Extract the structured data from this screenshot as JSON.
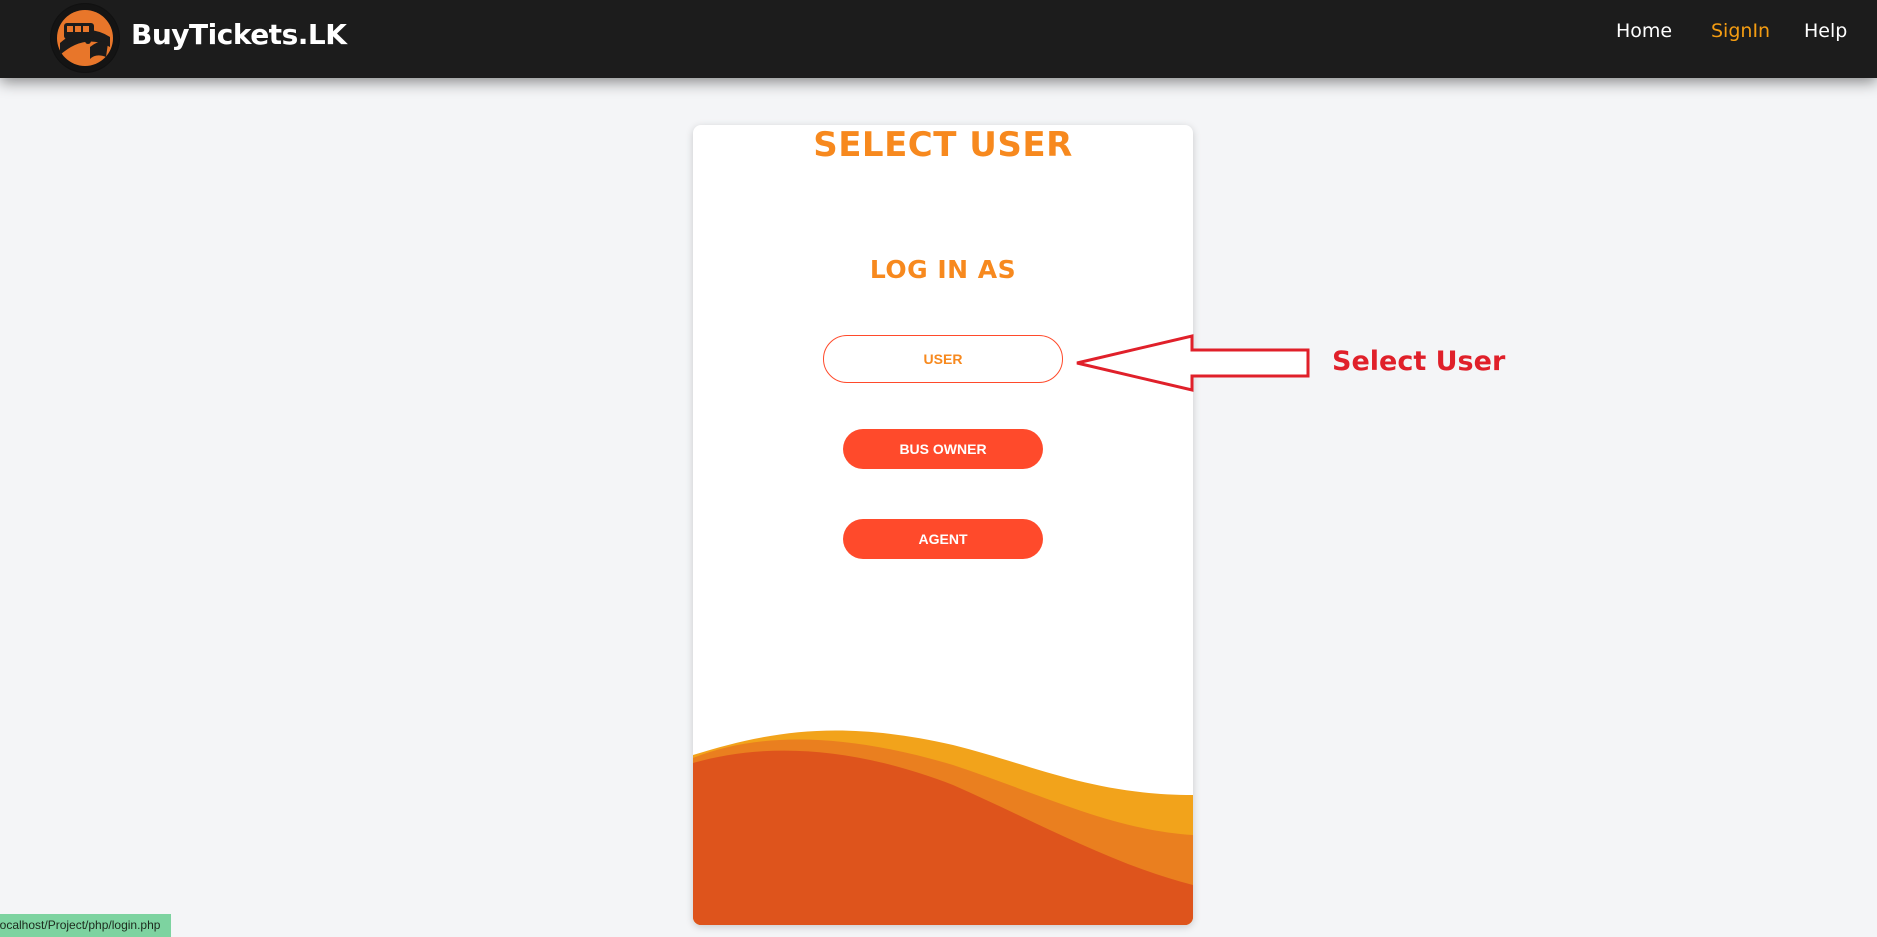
{
  "header": {
    "brand": "BuyTickets.LK",
    "nav": [
      {
        "label": "Home",
        "active": false
      },
      {
        "label": "SignIn",
        "active": true
      },
      {
        "label": "Help",
        "active": false
      }
    ],
    "logo_icon": "bus-logo-icon"
  },
  "card": {
    "title": "SELECT USER",
    "subtitle": "LOG IN AS",
    "buttons": {
      "user": "USER",
      "bus_owner": "BUS OWNER",
      "agent": "AGENT"
    }
  },
  "annotation": {
    "label": "Select User",
    "icon": "left-arrow-icon"
  },
  "status_bar": {
    "url": "localhost/Project/php/login.php"
  },
  "colors": {
    "nav_bg": "#1c1c1c",
    "accent_orange": "#f7891e",
    "button_red": "#ff4a2b",
    "annotation_red": "#e0202a",
    "wave_light": "#f2a31b",
    "wave_mid": "#ea7f1f",
    "wave_dark": "#de541c"
  }
}
